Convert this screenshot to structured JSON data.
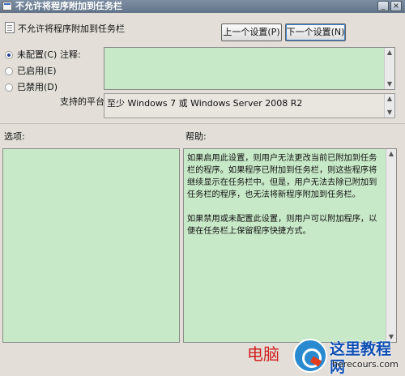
{
  "window": {
    "title": "不允许将程序附加到任务栏",
    "minimize_glyph": "_",
    "close_glyph": "×"
  },
  "header": {
    "setting_name": "不允许将程序附加到任务栏",
    "prev_button": "上一个设置(P)",
    "next_button": "下一个设置(N)"
  },
  "state": {
    "options": [
      {
        "label": "未配置(C)",
        "checked": true
      },
      {
        "label": "已启用(E)",
        "checked": false
      },
      {
        "label": "已禁用(D)",
        "checked": false
      }
    ]
  },
  "comment": {
    "label": "注释:",
    "value": "",
    "scroll_up": "▲",
    "scroll_down": "▼"
  },
  "platform": {
    "label": "支持的平台:",
    "value": "至少 Windows 7 或 Windows Server 2008 R2",
    "scroll_up": "▲",
    "scroll_down": "▼"
  },
  "options_section": {
    "label": "选项:"
  },
  "help_section": {
    "label": "帮助:",
    "paragraph1": "如果启用此设置，则用户无法更改当前已附加到任务栏的程序。如果程序已附加到任务栏，则这些程序将继续显示在任务栏中。但是，用户无法去除已附加到任务栏的程序，也无法将新程序附加到任务栏。",
    "paragraph2": "如果禁用或未配置此设置，则用户可以附加程序，以便在任务栏上保留程序快捷方式。",
    "scroll_up": "▲",
    "scroll_down": "▼"
  },
  "watermark": {
    "red_text": "电脑",
    "site_name_cn": "这里教程网",
    "site_domain": "herecours.com"
  }
}
